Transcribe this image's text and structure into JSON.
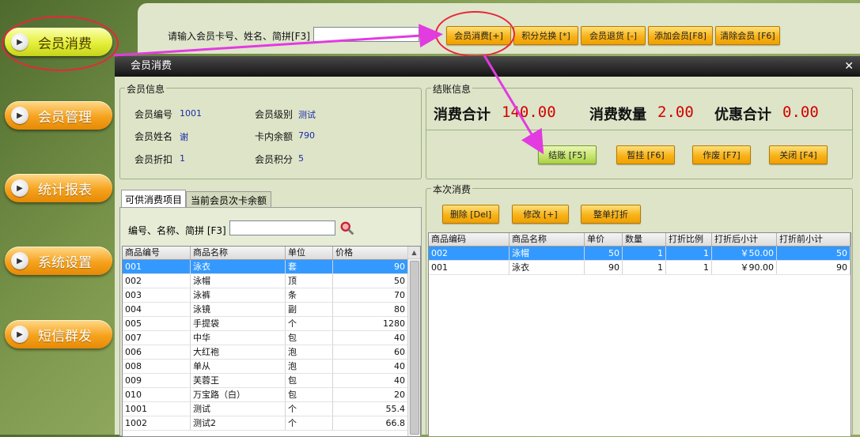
{
  "sidebar": {
    "items": [
      {
        "label": "会员消费",
        "active": true
      },
      {
        "label": "会员管理",
        "active": false
      },
      {
        "label": "统计报表",
        "active": false
      },
      {
        "label": "系统设置",
        "active": false
      },
      {
        "label": "短信群发",
        "active": false
      }
    ]
  },
  "search_bar": {
    "label": "请输入会员卡号、姓名、简拼[F3]",
    "value": "",
    "buttons": [
      "会员消费[+]",
      "积分兑换 [*]",
      "会员退货 [-]",
      "添加会员[F8]",
      "清除会员 [F6]"
    ]
  },
  "dialog": {
    "title": "会员消费",
    "member_info": {
      "title": "会员信息",
      "number_label": "会员编号",
      "number": "1001",
      "level_label": "会员级别",
      "level": "测试",
      "name_label": "会员姓名",
      "name": "谢",
      "balance_label": "卡内余额",
      "balance": "790",
      "discount_label": "会员折扣",
      "discount": "1",
      "points_label": "会员积分",
      "points": "5"
    },
    "checkout": {
      "title": "结账信息",
      "total_label": "消费合计",
      "total": "140.00",
      "qty_label": "消费数量",
      "qty": "2.00",
      "discount_label": "优惠合计",
      "discount_total": "0.00",
      "buttons": {
        "checkout": "结账 [F5]",
        "hold": "暂挂 [F6]",
        "void": "作废 [F7]",
        "close": "关闭 [F4]"
      }
    },
    "tabs": [
      "可供消费项目",
      "当前会员次卡余额"
    ],
    "product_search_label": "编号、名称、简拼 [F3]",
    "product_search_value": "",
    "product_table": {
      "columns": [
        "商品编号",
        "商品名称",
        "单位",
        "价格"
      ],
      "rows": [
        [
          "001",
          "泳衣",
          "套",
          "90"
        ],
        [
          "002",
          "泳帽",
          "顶",
          "50"
        ],
        [
          "003",
          "泳裤",
          "条",
          "70"
        ],
        [
          "004",
          "泳镜",
          "副",
          "80"
        ],
        [
          "005",
          "手提袋",
          "个",
          "1280"
        ],
        [
          "007",
          "中华",
          "包",
          "40"
        ],
        [
          "006",
          "大红袍",
          "泡",
          "60"
        ],
        [
          "008",
          "单从",
          "泡",
          "40"
        ],
        [
          "009",
          "芙蓉王",
          "包",
          "40"
        ],
        [
          "010",
          "万宝路（白）",
          "包",
          "20"
        ],
        [
          "1001",
          "测试",
          "个",
          "55.4"
        ],
        [
          "1002",
          "测试2",
          "个",
          "66.8"
        ]
      ]
    },
    "current": {
      "title": "本次消费",
      "buttons": {
        "delete": "删除 [Del]",
        "modify": "修改 [+]",
        "whole_discount": "整单打折"
      },
      "columns": [
        "商品编码",
        "商品名称",
        "单价",
        "数量",
        "打折比例",
        "打折后小计",
        "打折前小计"
      ],
      "rows": [
        [
          "002",
          "泳帽",
          "50",
          "1",
          "1",
          "￥50.00",
          "50"
        ],
        [
          "001",
          "泳衣",
          "90",
          "1",
          "1",
          "￥90.00",
          "90"
        ]
      ]
    }
  },
  "colors": {
    "accent_orange": "#f7b31a",
    "highlight_red": "#e8263b",
    "arrow_magenta": "#e23be0",
    "select_blue": "#3399ff"
  },
  "icons": [
    "play-icon",
    "search-icon",
    "close-icon"
  ]
}
